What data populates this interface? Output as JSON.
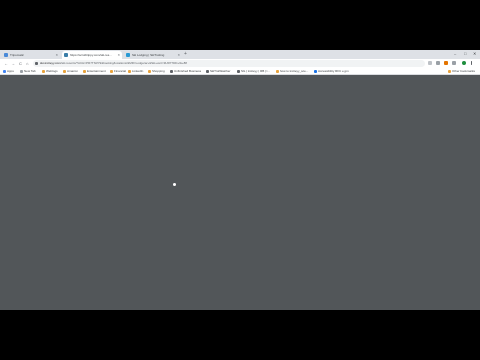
{
  "tabs": [
    {
      "title": "Tripomatic",
      "active": false,
      "favicon_color": "#4a8ad8"
    },
    {
      "title": "https://scrolltrippy.com/ski-res...",
      "active": true,
      "favicon_color": "#3c7ea8"
    },
    {
      "title": "Ski Lodging | SkiTrotting",
      "active": false,
      "favicon_color": "#2a9ad4"
    }
  ],
  "new_tab_label": "+",
  "window_controls": [
    "–",
    "□",
    "✕"
  ],
  "address_bar": {
    "host": "ski-trotteyy.com",
    "path": "/ski-resorts/?ACH=PR7TN3Y9&booking/locations/&MR=Lodge/a/+&Ski+vert=9UR77DD+l&+88"
  },
  "nav": {
    "back": "←",
    "forward": "→",
    "reload": "C",
    "home": "⌂"
  },
  "bookmarks": [
    {
      "label": "Apps"
    },
    {
      "label": "New Tab"
    },
    {
      "label": "Weblogs"
    },
    {
      "label": "Amazon"
    },
    {
      "label": "Entertainment"
    },
    {
      "label": "Financial"
    },
    {
      "label": "LinkedIn"
    },
    {
      "label": "Shopping"
    },
    {
      "label": "Unfinished Business"
    },
    {
      "label": "SkiTrotWatcher"
    },
    {
      "label": "SG | trotteyy | RB | l..."
    },
    {
      "label": "how to trotteyy_sce..."
    },
    {
      "label": "Accessibility RFC e.jpn"
    }
  ],
  "other_bookmarks": "Other bookmarks",
  "colors": {
    "page_background": "#525659",
    "tab_strip": "#dee1e6",
    "letterbox": "#000000"
  }
}
